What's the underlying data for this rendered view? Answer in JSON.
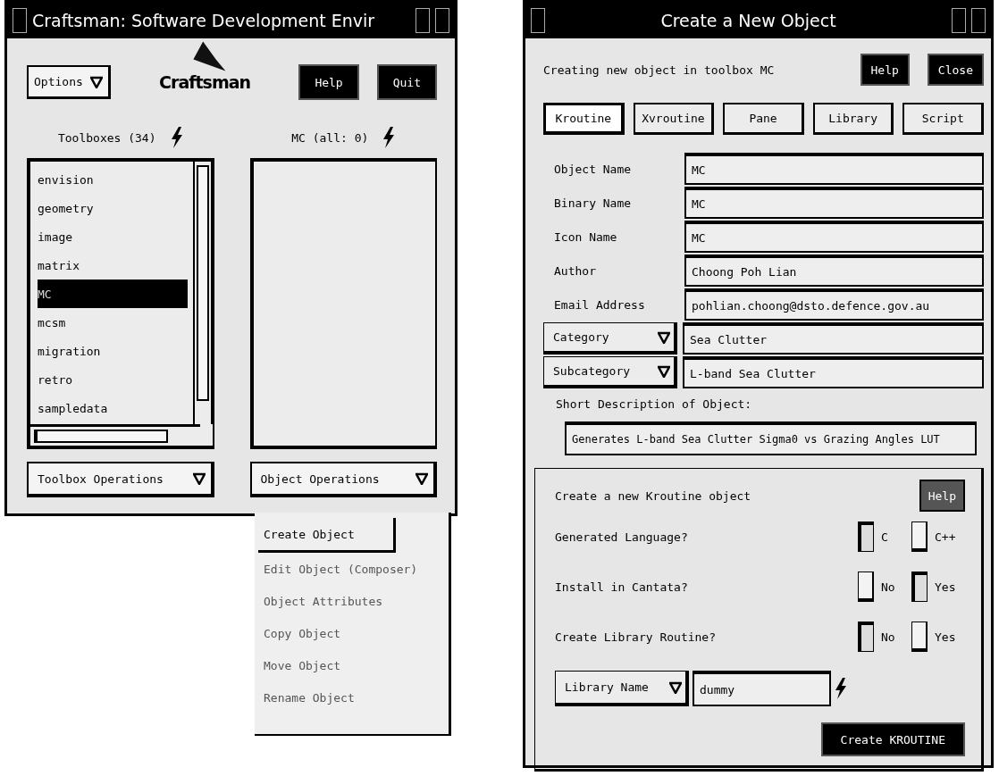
{
  "toolbox_window": {
    "title": "Craftsman: Software Development Envir",
    "logo": "Craftsman",
    "options_menu": "Options",
    "buttons": [
      "Help",
      "Quit"
    ],
    "toolboxes_label": "Toolboxes (34)",
    "objects_label": "MC (all: 0)",
    "toolboxes": [
      {
        "name": "envision",
        "selected": false
      },
      {
        "name": "geometry",
        "selected": false
      },
      {
        "name": "image",
        "selected": false
      },
      {
        "name": "matrix",
        "selected": false
      },
      {
        "name": "MC",
        "selected": true
      },
      {
        "name": "mcsm",
        "selected": false
      },
      {
        "name": "migration",
        "selected": false
      },
      {
        "name": "retro",
        "selected": false
      },
      {
        "name": "sampledata",
        "selected": false
      }
    ],
    "toolbox_operations": "Toolbox Operations",
    "object_operations": "Object Operations"
  },
  "object_menu": {
    "items": [
      {
        "label": "Create Object",
        "selected": true
      },
      {
        "label": "Edit Object (Composer)",
        "selected": false
      },
      {
        "label": "Object Attributes",
        "selected": false
      },
      {
        "label": "Copy Object",
        "selected": false
      },
      {
        "label": "Move Object",
        "selected": false
      },
      {
        "label": "Rename Object",
        "selected": false
      }
    ]
  },
  "create_window": {
    "title": "Create a New Object",
    "message": "Creating new object in toolbox MC",
    "buttons": [
      "Help",
      "Close"
    ],
    "tabs": [
      {
        "label": "Kroutine",
        "selected": true
      },
      {
        "label": "Xvroutine",
        "selected": false
      },
      {
        "label": "Pane",
        "selected": false
      },
      {
        "label": "Library",
        "selected": false
      },
      {
        "label": "Script",
        "selected": false
      }
    ],
    "fields": [
      {
        "label": "Object Name",
        "value": "MC"
      },
      {
        "label": "Binary Name",
        "value": "MC"
      },
      {
        "label": "Icon Name",
        "value": "MC"
      },
      {
        "label": "Author",
        "value": "Choong Poh Lian"
      },
      {
        "label": "Email Address",
        "value": "pohlian.choong@dsto.defence.gov.au"
      }
    ],
    "menu_fields": [
      {
        "label": "Category",
        "value": "Sea Clutter"
      },
      {
        "label": "Subcategory",
        "value": "L-band Sea Clutter"
      }
    ],
    "description_label": "Short Description of Object:",
    "description": "Generates L-band Sea Clutter Sigma0 vs Grazing Angles LUT",
    "panel": {
      "title": "Create a new Kroutine object",
      "help": "Help",
      "questions": [
        {
          "label": "Generated Language?",
          "options": [
            {
              "label": "C",
              "checked": true
            },
            {
              "label": "C++",
              "checked": false
            }
          ]
        },
        {
          "label": "Install in Cantata?",
          "options": [
            {
              "label": "No",
              "checked": false
            },
            {
              "label": "Yes",
              "checked": true
            }
          ]
        },
        {
          "label": "Create Library Routine?",
          "options": [
            {
              "label": "No",
              "checked": true
            },
            {
              "label": "Yes",
              "checked": false
            }
          ]
        }
      ],
      "library_menu": "Library Name",
      "library_value": "dummy",
      "create_button": "Create KROUTINE"
    }
  }
}
